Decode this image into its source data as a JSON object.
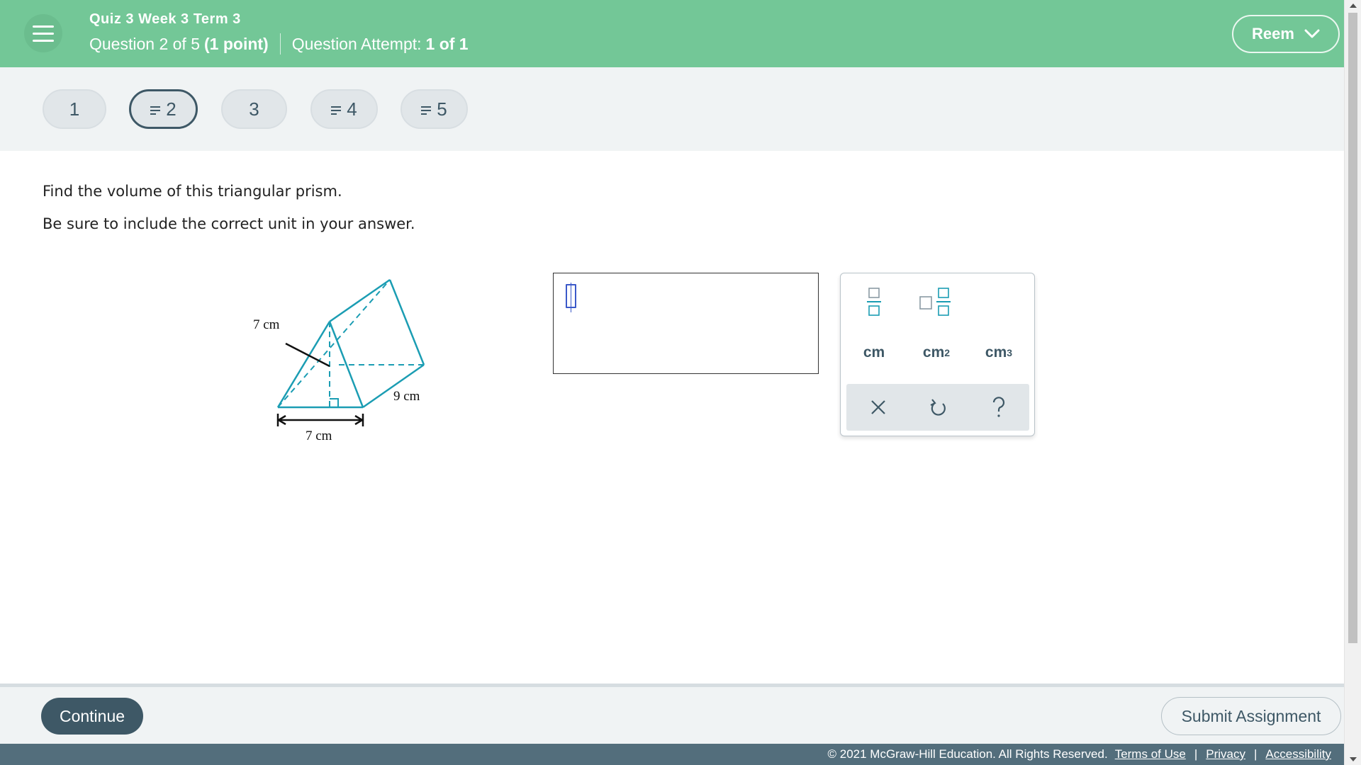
{
  "header": {
    "quiz_title": "Quiz 3 Week 3 Term 3",
    "question_progress": "Question 2 of 5",
    "question_points": "(1 point)",
    "attempt_label": "Question Attempt:",
    "attempt_value": "1 of 1",
    "user_name": "Reem"
  },
  "question_nav": [
    {
      "label": "1",
      "answered": false,
      "active": false
    },
    {
      "label": "2",
      "answered": true,
      "active": true
    },
    {
      "label": "3",
      "answered": false,
      "active": false
    },
    {
      "label": "4",
      "answered": true,
      "active": false
    },
    {
      "label": "5",
      "answered": true,
      "active": false
    }
  ],
  "question": {
    "line1": "Find the volume of this triangular prism.",
    "line2": "Be sure to include the correct unit in your answer."
  },
  "figure": {
    "height_label": "7 cm",
    "base_label": "7 cm",
    "length_label": "9 cm"
  },
  "answer": {
    "value": ""
  },
  "palette": {
    "units": [
      "cm",
      "cm",
      "cm"
    ],
    "unit_powers": [
      "",
      "2",
      "3"
    ],
    "tools": [
      "clear-icon",
      "undo-icon",
      "help-icon"
    ]
  },
  "footer": {
    "continue_label": "Continue",
    "submit_label": "Submit Assignment",
    "copyright": "© 2021 McGraw-Hill Education. All Rights Reserved.",
    "terms": "Terms of Use",
    "privacy": "Privacy",
    "accessibility": "Accessibility"
  },
  "colors": {
    "header": "#73c797",
    "primary_dark": "#3e5866",
    "teal_figure": "#1b9db3",
    "footer_bar": "#536e7c"
  }
}
